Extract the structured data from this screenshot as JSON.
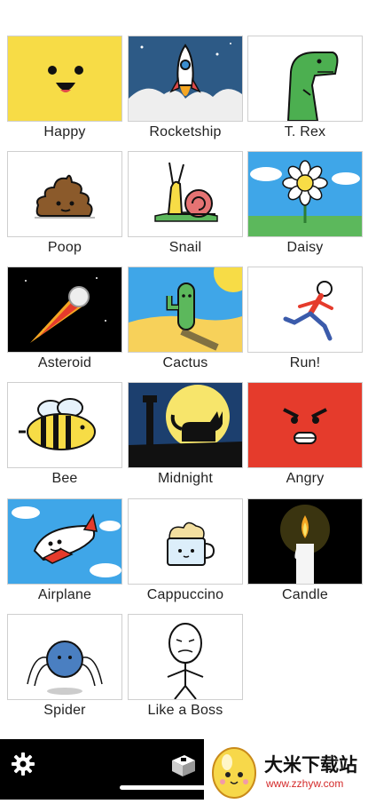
{
  "stickers": [
    {
      "label": "Happy",
      "icon": "happy-face-icon",
      "bg": "#f7dc46"
    },
    {
      "label": "Rocketship",
      "icon": "rocket-icon",
      "bg": "#2d5a86"
    },
    {
      "label": "T. Rex",
      "icon": "trex-icon",
      "bg": "#ffffff"
    },
    {
      "label": "Poop",
      "icon": "poop-icon",
      "bg": "#ffffff"
    },
    {
      "label": "Snail",
      "icon": "snail-icon",
      "bg": "#ffffff"
    },
    {
      "label": "Daisy",
      "icon": "daisy-icon",
      "bg": "#3fa6e8"
    },
    {
      "label": "Asteroid",
      "icon": "asteroid-icon",
      "bg": "#000000"
    },
    {
      "label": "Cactus",
      "icon": "cactus-icon",
      "bg": "#3fa6e8"
    },
    {
      "label": "Run!",
      "icon": "runner-icon",
      "bg": "#ffffff"
    },
    {
      "label": "Bee",
      "icon": "bee-icon",
      "bg": "#ffffff"
    },
    {
      "label": "Midnight",
      "icon": "black-cat-icon",
      "bg": "#1c3f6e"
    },
    {
      "label": "Angry",
      "icon": "angry-face-icon",
      "bg": "#e53b2c"
    },
    {
      "label": "Airplane",
      "icon": "airplane-icon",
      "bg": "#3fa6e8"
    },
    {
      "label": "Cappuccino",
      "icon": "cappuccino-icon",
      "bg": "#ffffff"
    },
    {
      "label": "Candle",
      "icon": "candle-icon",
      "bg": "#000000"
    },
    {
      "label": "Spider",
      "icon": "spider-icon",
      "bg": "#ffffff"
    },
    {
      "label": "Like a Boss",
      "icon": "like-a-boss-icon",
      "bg": "#ffffff"
    }
  ],
  "toolbar": {
    "settings_icon": "gear-icon",
    "app_icon": "app-icon"
  },
  "watermark": {
    "title": "大米下载站",
    "url": "www.zzhyw.com"
  }
}
